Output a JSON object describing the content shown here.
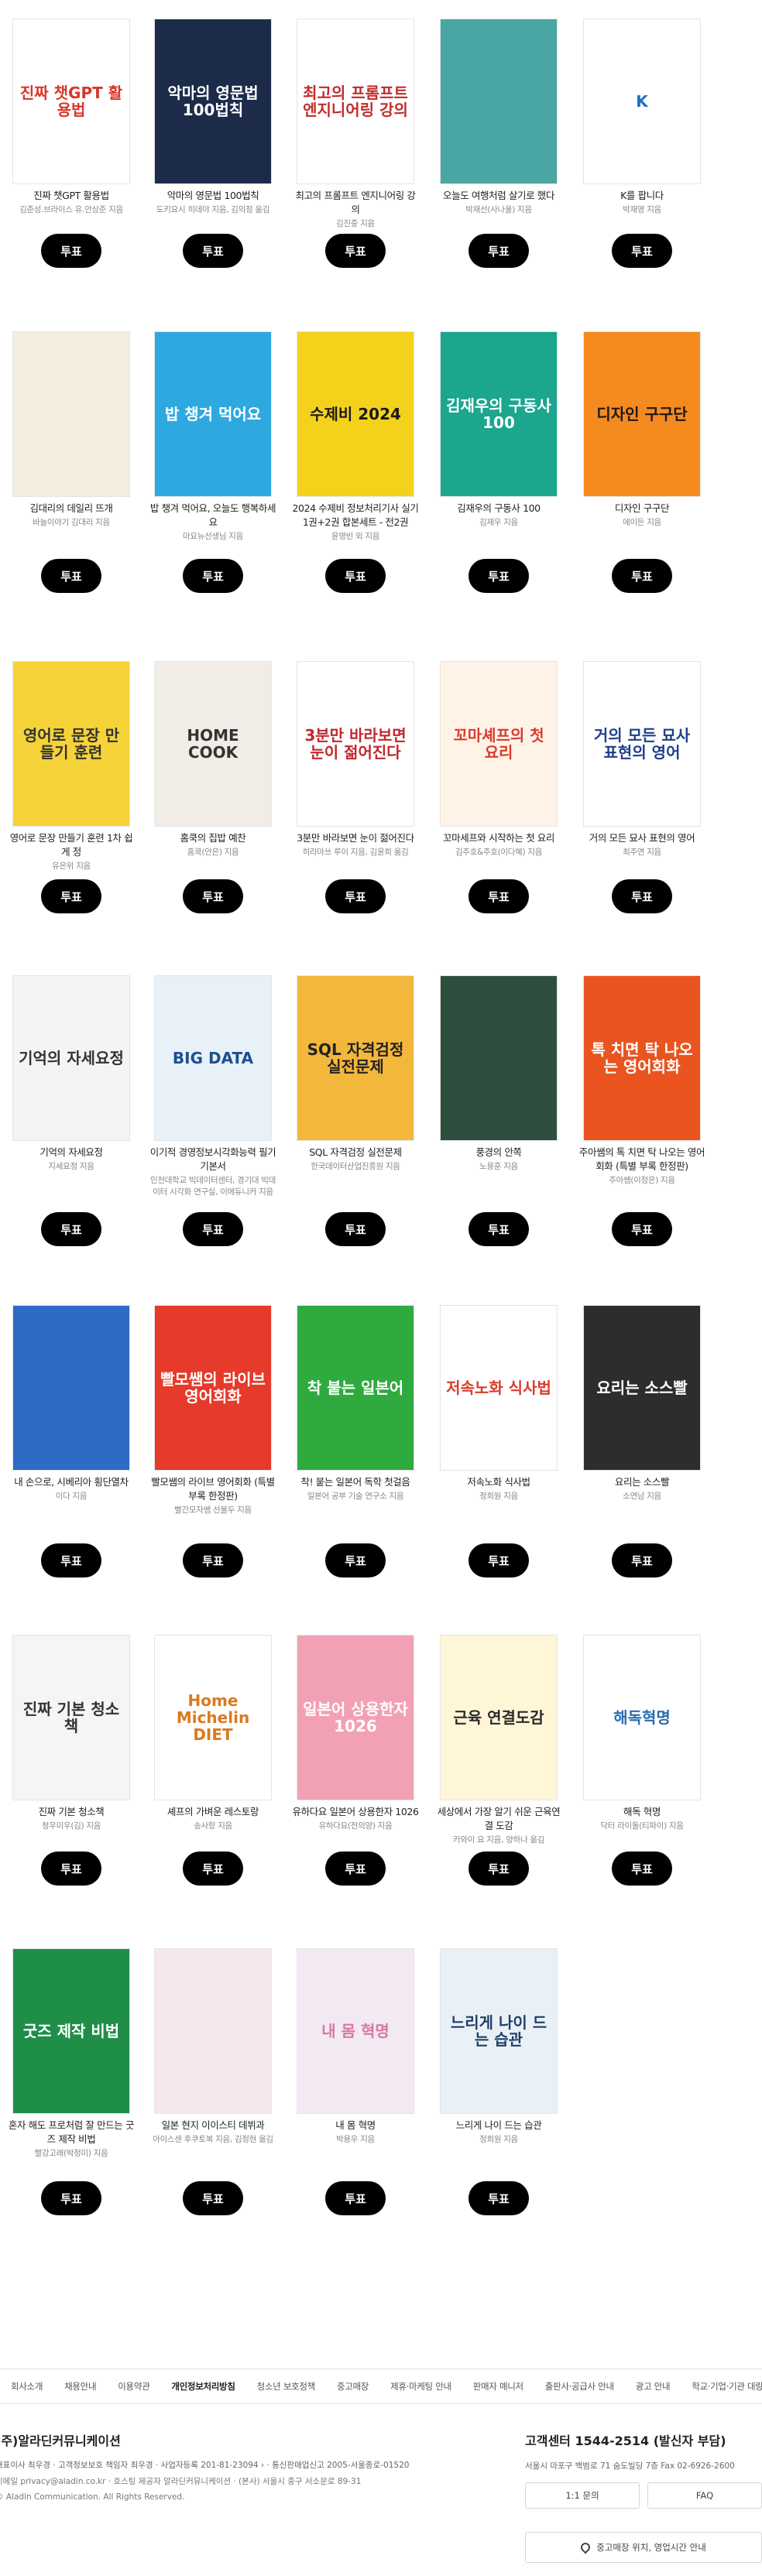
{
  "vote_label": "투표",
  "books": [
    {
      "title": "진짜 챗GPT 활용법",
      "author": "김준성.브라이스 유.안상준 지음",
      "cover_text": "진짜 챗GPT 활용법",
      "bg": "#ffffff",
      "fg": "#d9352b"
    },
    {
      "title": "악마의 영문법 100법칙",
      "author": "도키요시 히데야 지음, 김의정 옮김",
      "cover_text": "악마의 영문법 100법칙",
      "bg": "#1c2b4a",
      "fg": "#ffffff"
    },
    {
      "title": "최고의 프롬프트 엔지니어링 강의",
      "author": "김진중 지음",
      "cover_text": "최고의 프롬프트 엔지니어링 강의",
      "bg": "#ffffff",
      "fg": "#c12c2c"
    },
    {
      "title": "오늘도 여행처럼 살기로 했다",
      "author": "박재선(사나울) 지음",
      "cover_text": "",
      "bg": "#4aa6a2",
      "fg": "#ffffff"
    },
    {
      "title": "K를 팝니다",
      "author": "박재영 지음",
      "cover_text": "K",
      "bg": "#ffffff",
      "fg": "#1e6fc9"
    },
    {
      "title": "김대리의 데일리 뜨개",
      "author": "바늘이야기 김대리 지음",
      "cover_text": "",
      "bg": "#f3eee0",
      "fg": "#5a4a30"
    },
    {
      "title": "밥 챙겨 먹어요, 오늘도 행복하세요",
      "author": "마요뉴선생님 지음",
      "cover_text": "밥 챙겨 먹어요",
      "bg": "#2ea9e0",
      "fg": "#ffffff"
    },
    {
      "title": "2024 수제비 정보처리기사 실기 1권+2권 합본세트 - 전2권",
      "author": "윤영빈 외 지음",
      "cover_text": "수제비 2024",
      "bg": "#f4d21c",
      "fg": "#1a1a1a"
    },
    {
      "title": "김재우의 구동사 100",
      "author": "김재우 지음",
      "cover_text": "김재우의 구동사 100",
      "bg": "#1ba68d",
      "fg": "#ffffff"
    },
    {
      "title": "디자인 구구단",
      "author": "에이든 지음",
      "cover_text": "디자인 구구단",
      "bg": "#f58a1f",
      "fg": "#1a1a1a"
    },
    {
      "title": "영어로 문장 만들기 훈련 1차 쉽게 정",
      "author": "유은위 지음",
      "cover_text": "영어로 문장 만들기 훈련",
      "bg": "#f7d33a",
      "fg": "#333333"
    },
    {
      "title": "홈쿡의 집밥 예찬",
      "author": "홈쿡(안은) 지음",
      "cover_text": "HOME COOK",
      "bg": "#f1ede6",
      "fg": "#333333"
    },
    {
      "title": "3분만 바라보면 눈이 젊어진다",
      "author": "히라마쓰 루이 지음, 김윤희 옮김",
      "cover_text": "3분만 바라보면 눈이 젊어진다",
      "bg": "#ffffff",
      "fg": "#c0282d"
    },
    {
      "title": "꼬마세프와 시작하는 첫 요리",
      "author": "김주호&주호(이다혜) 지음",
      "cover_text": "꼬마셰프의 첫 요리",
      "bg": "#fff3e8",
      "fg": "#d93b2f"
    },
    {
      "title": "거의 모든 묘사 표현의 영어",
      "author": "최주연 지음",
      "cover_text": "거의 모든 묘사 표현의 영어",
      "bg": "#ffffff",
      "fg": "#1f3f8a"
    },
    {
      "title": "기억의 자세요정",
      "author": "지세요정 지음",
      "cover_text": "기억의 자세요정",
      "bg": "#f4f4f4",
      "fg": "#333333"
    },
    {
      "title": "이기적 경영정보시각화능력 필기 기본서",
      "author": "인천대학교 빅데이터센터, 경기대 빅데이터 시각화 연구실, 이에듀니커 지음",
      "cover_text": "BIG DATA",
      "bg": "#e8f1f8",
      "fg": "#1d4f91"
    },
    {
      "title": "SQL 자격검정 실전문제",
      "author": "한국데이터산업진흥원 지음",
      "cover_text": "SQL 자격검정 실전문제",
      "bg": "#f3b73b",
      "fg": "#222222"
    },
    {
      "title": "풍경의 안쪽",
      "author": "노용훈 지음",
      "cover_text": "",
      "bg": "#2f4f3e",
      "fg": "#ffffff"
    },
    {
      "title": "주아쌤의 톡 치면 탁 나오는 영어회화 (특별 부록 한정판)",
      "author": "주아쌤(이정은) 지음",
      "cover_text": "톡 치면 탁 나오는 영어회화",
      "bg": "#e9541f",
      "fg": "#ffffff"
    },
    {
      "title": "내 손으로, 시베리아 횡단열차",
      "author": "이다 지음",
      "cover_text": "",
      "bg": "#2e6bc6",
      "fg": "#ffffff"
    },
    {
      "title": "빨모쌤의 라이브 영어회화 (특별 부록 한정판)",
      "author": "빨간모자쌤 선물두 지음",
      "cover_text": "빨모쌤의 라이브 영어회화",
      "bg": "#e63a2a",
      "fg": "#ffffff"
    },
    {
      "title": "착! 붙는 일본어 독학 첫걸음",
      "author": "일본어 공부 기술 연구소 지음",
      "cover_text": "착 붙는 일본어",
      "bg": "#2faa3f",
      "fg": "#ffffff"
    },
    {
      "title": "저속노화 식사법",
      "author": "정희원 지음",
      "cover_text": "저속노화 식사법",
      "bg": "#ffffff",
      "fg": "#d93b2f"
    },
    {
      "title": "요리는 소스빨",
      "author": "소연남 지음",
      "cover_text": "요리는 소스빨",
      "bg": "#2d2d2d",
      "fg": "#ffffff"
    },
    {
      "title": "진짜 기본 청소책",
      "author": "청우미우(김) 지음",
      "cover_text": "진짜 기본 청소책",
      "bg": "#f5f5f5",
      "fg": "#333333"
    },
    {
      "title": "셰프의 가벼운 레스토랑",
      "author": "송사항 지음",
      "cover_text": "Home Michelin DIET",
      "bg": "#ffffff",
      "fg": "#d97a1f"
    },
    {
      "title": "유하다요 일본어 상용한자 1026",
      "author": "유하다요(전의양) 지음",
      "cover_text": "일본어 상용한자 1026",
      "bg": "#f2a1b4",
      "fg": "#ffffff"
    },
    {
      "title": "세상에서 가장 알기 쉬운 근육연결 도감",
      "author": "카와이 요 지음, 양하나 옮김",
      "cover_text": "근육 연결도감",
      "bg": "#fff6d8",
      "fg": "#2a2a2a"
    },
    {
      "title": "해독 혁명",
      "author": "닥터 라이돌(티파이) 지음",
      "cover_text": "해독혁명",
      "bg": "#ffffff",
      "fg": "#2b6cb0"
    },
    {
      "title": "혼자 해도 프로처럼 잘 만드는 굿즈 제작 비법",
      "author": "빨강고래(박정미) 지음",
      "cover_text": "굿즈 제작 비법",
      "bg": "#1f8f48",
      "fg": "#ffffff"
    },
    {
      "title": "일본 현지 이이스티 데뷔과",
      "author": "아이스센 후쿠토복 지음, 김정현 옮김",
      "cover_text": "",
      "bg": "#f6e7ef",
      "fg": "#333333"
    },
    {
      "title": "내 몸 혁명",
      "author": "박용우 지음",
      "cover_text": "내 몸 혁명",
      "bg": "#f3e9f3",
      "fg": "#d67aa1"
    },
    {
      "title": "느리게 나이 드는 습관",
      "author": "정희원 지음",
      "cover_text": "느리게 나이 드는 습관",
      "bg": "#eaf1f6",
      "fg": "#1e3f6a"
    }
  ],
  "footer": {
    "links": [
      "회사소개",
      "채용안내",
      "이용약관",
      "개인정보처리방침",
      "청소년 보호정책",
      "중고매장",
      "제휴·마케팅 안내",
      "판매자 매니저",
      "출판사·공급사 안내",
      "광고 안내",
      "학교·기업·기관 대량구매"
    ],
    "company_name": "(주)알라딘커뮤니케이션",
    "info1": "대표이사 최우경 · 고객정보보호 책임자 최우경 · 사업자등록 201-81-23094 › · 통신판매업신고 2005-서울종로-01520",
    "info2": "이메일 privacy@aladin.co.kr · 호스팅 제공자 알라딘커뮤니케이션 · (본사) 서울시 중구 서소문로 89-31",
    "copyright": "© Aladin Communication. All Rights Reserved.",
    "cs_title": "고객센터 1544-2514 (발신자 부담)",
    "cs_addr": "서울시 마포구 백범로 71 숨도빌딩 7층 Fax 02-6926-2600",
    "btn_inquiry": "1:1 문의",
    "btn_faq": "FAQ",
    "store_label": "중고매장 위치, 영업시간 안내"
  }
}
